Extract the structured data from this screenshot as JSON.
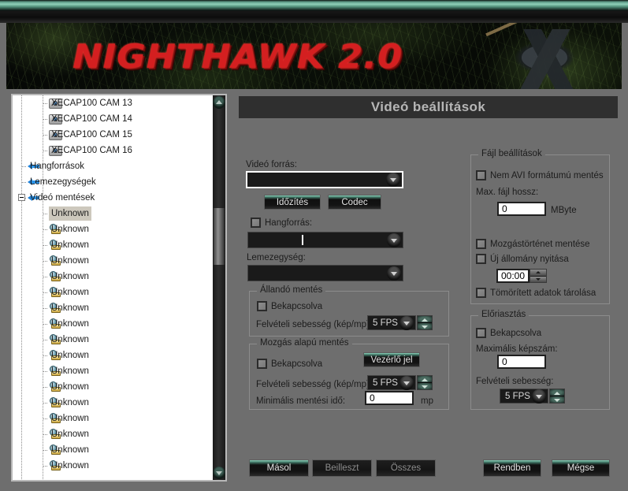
{
  "app": {
    "logo_text": "NIGHTHAWK 2.0",
    "panel_title": "Videó beállítások"
  },
  "tree": {
    "items": [
      {
        "label": "XECAP100 CAM 13",
        "icon": "camera-icon",
        "depth": 2,
        "selected": false
      },
      {
        "label": "XECAP100 CAM 14",
        "icon": "camera-icon",
        "depth": 2,
        "selected": false
      },
      {
        "label": "XECAP100 CAM 15",
        "icon": "camera-icon",
        "depth": 2,
        "selected": false
      },
      {
        "label": "XECAP100 CAM 16",
        "icon": "camera-icon",
        "depth": 2,
        "selected": false
      },
      {
        "label": "Hangforrások",
        "icon": "blue-arrow-icon",
        "depth": 1,
        "selected": false
      },
      {
        "label": "Lemezegységek",
        "icon": "blue-arrow-icon",
        "depth": 1,
        "selected": false
      },
      {
        "label": "Videó mentések",
        "icon": "blue-arrow-icon",
        "depth": 1,
        "selected": false,
        "expander": "minus"
      },
      {
        "label": "Unknown",
        "icon": "gear-icon",
        "depth": 2,
        "selected": true
      },
      {
        "label": "Unknown",
        "icon": "gear-icon",
        "depth": 2,
        "selected": false
      },
      {
        "label": "Unknown",
        "icon": "gear-icon",
        "depth": 2,
        "selected": false
      },
      {
        "label": "Unknown",
        "icon": "gear-icon",
        "depth": 2,
        "selected": false
      },
      {
        "label": "Unknown",
        "icon": "gear-icon",
        "depth": 2,
        "selected": false
      },
      {
        "label": "Unknown",
        "icon": "gear-icon",
        "depth": 2,
        "selected": false
      },
      {
        "label": "Unknown",
        "icon": "gear-icon",
        "depth": 2,
        "selected": false
      },
      {
        "label": "Unknown",
        "icon": "gear-icon",
        "depth": 2,
        "selected": false
      },
      {
        "label": "Unknown",
        "icon": "gear-icon",
        "depth": 2,
        "selected": false
      },
      {
        "label": "Unknown",
        "icon": "gear-icon",
        "depth": 2,
        "selected": false
      },
      {
        "label": "Unknown",
        "icon": "gear-icon",
        "depth": 2,
        "selected": false
      },
      {
        "label": "Unknown",
        "icon": "gear-icon",
        "depth": 2,
        "selected": false
      },
      {
        "label": "Unknown",
        "icon": "gear-icon",
        "depth": 2,
        "selected": false
      },
      {
        "label": "Unknown",
        "icon": "gear-icon",
        "depth": 2,
        "selected": false
      },
      {
        "label": "Unknown",
        "icon": "gear-icon",
        "depth": 2,
        "selected": false
      },
      {
        "label": "Unknown",
        "icon": "gear-icon",
        "depth": 2,
        "selected": false
      },
      {
        "label": "Unknown",
        "icon": "gear-icon",
        "depth": 2,
        "selected": false
      }
    ],
    "scrollbar": {
      "up_icon": "scroll-up-icon",
      "down_icon": "scroll-down-icon"
    }
  },
  "form": {
    "video_source_label": "Videó forrás:",
    "video_source_value": "",
    "timing_button": "Időzítés",
    "codec_button": "Codec",
    "audio_source_label": "Hangforrás:",
    "audio_source_value": "",
    "disk_label": "Lemezegység:",
    "disk_value": "",
    "constant": {
      "title": "Állandó mentés",
      "enabled_label": "Bekapcsolva",
      "fps_label": "Felvételi sebesség (kép/mp):",
      "fps_value": "5 FPS"
    },
    "motion": {
      "title": "Mozgás alapú mentés",
      "enabled_label": "Bekapcsolva",
      "trigger_button": "Vezérlő jel",
      "fps_label": "Felvételi sebesség (kép/mp):",
      "fps_value": "5 FPS",
      "min_time_label": "Minimális mentési idő:",
      "min_time_value": "0",
      "min_time_unit": "mp"
    },
    "file": {
      "title": "Fájl beállítások",
      "non_avi_label": "Nem AVI formátumú mentés",
      "max_len_label": "Max. fájl hossz:",
      "max_len_value": "0",
      "max_len_unit": "MByte",
      "motion_history_label": "Mozgástörténet mentése",
      "new_file_label": "Új állomány nyitása",
      "new_file_time": "00:00",
      "compressed_label": "Tömörített adatok tárolása"
    },
    "prealarm": {
      "title": "Előriasztás",
      "enabled_label": "Bekapcsolva",
      "max_frames_label": "Maximális képszám:",
      "max_frames_value": "0",
      "fps_label": "Felvételi sebesség:",
      "fps_value": "5 FPS"
    }
  },
  "buttons": {
    "copy": "Másol",
    "paste": "Beilleszt",
    "all": "Összes",
    "ok": "Rendben",
    "cancel": "Mégse"
  },
  "colors": {
    "accent_green": "#8ad3bb",
    "panel_bg": "#6e6e6e",
    "title_bar": "#2f2f2f",
    "logo_red": "#d41f20"
  }
}
